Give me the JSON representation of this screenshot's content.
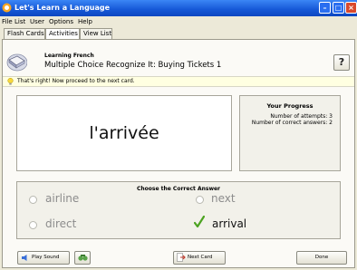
{
  "window": {
    "title": "Let's Learn a Language"
  },
  "menubar": {
    "items": [
      "File",
      "List",
      "User",
      "Options",
      "Help"
    ]
  },
  "tabs": [
    "Flash Cards",
    "Activities",
    "View List"
  ],
  "header": {
    "subtitle": "Learning French",
    "title": "Multiple Choice Recognize It: Buying Tickets 1",
    "help_label": "?"
  },
  "info": {
    "message": "That's right! Now proceed to the next card."
  },
  "card": {
    "word": "l'arrivée"
  },
  "progress": {
    "heading": "Your Progress",
    "attempts": "Number of attempts: 3",
    "correct": "Number of correct answers: 2"
  },
  "choices": {
    "heading": "Choose the Correct Answer",
    "options": [
      "airline",
      "next",
      "direct",
      "arrival"
    ],
    "selected": "arrival"
  },
  "buttons": {
    "play_sound": "Play Sound",
    "next_card": "Next Card",
    "done": "Done"
  },
  "colors": {
    "titlebar": "#1557d6",
    "correct_check": "#4ca321",
    "info_bg": "#ffffe1"
  }
}
